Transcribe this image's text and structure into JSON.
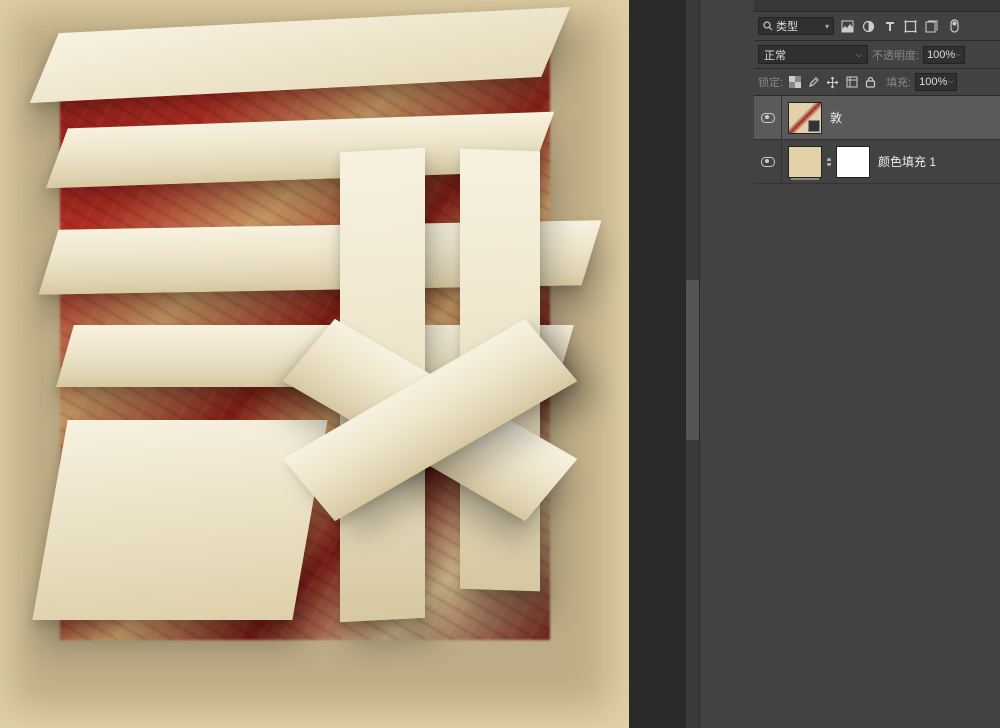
{
  "filter": {
    "label": "类型"
  },
  "blend": {
    "mode": "正常",
    "opacity_label": "不透明度:",
    "opacity_value": "100%"
  },
  "lock": {
    "label": "锁定:",
    "fill_label": "填充:",
    "fill_value": "100%"
  },
  "layers": [
    {
      "name": "敦"
    },
    {
      "name": "颜色填充 1"
    }
  ]
}
